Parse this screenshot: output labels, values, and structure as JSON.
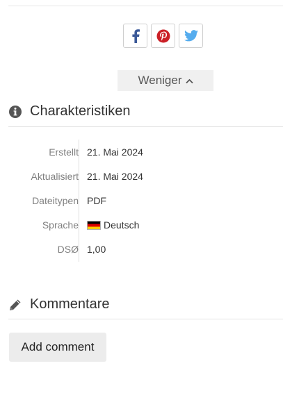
{
  "share": {
    "items": [
      {
        "name": "facebook",
        "icon": "facebook-icon",
        "color": "#3b5998"
      },
      {
        "name": "pinterest",
        "icon": "pinterest-icon",
        "color": "#cb2027"
      },
      {
        "name": "twitter",
        "icon": "twitter-icon",
        "color": "#55acee"
      }
    ]
  },
  "toggle": {
    "label": "Weniger",
    "icon": "chevron-up-icon"
  },
  "characteristics": {
    "title": "Charakteristiken",
    "icon": "info-icon",
    "rows": [
      {
        "label": "Erstellt",
        "value": "21. Mai 2024"
      },
      {
        "label": "Aktualisiert",
        "value": "21. Mai 2024"
      },
      {
        "label": "Dateitypen",
        "value": "PDF"
      },
      {
        "label": "Sprache",
        "value": "Deutsch",
        "icon": "german-flag-icon"
      },
      {
        "label": "DSØ",
        "value": "1,00"
      }
    ]
  },
  "comments": {
    "title": "Kommentare",
    "icon": "pencil-icon",
    "add_label": "Add comment"
  }
}
